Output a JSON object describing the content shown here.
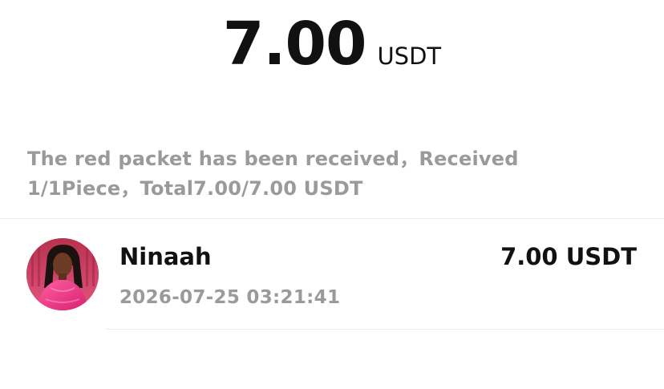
{
  "header": {
    "amount": "7.00",
    "unit": "USDT"
  },
  "summary": {
    "line1": "The red packet has been received，Received",
    "line2": "1/1Piece，Total7.00/7.00 USDT"
  },
  "records": [
    {
      "name": "Ninaah",
      "time": "2026-07-25 03:21:41",
      "amount": "7.00 USDT",
      "avatar_icon": "user-avatar-photo"
    }
  ],
  "colors": {
    "text_primary": "#111111",
    "text_secondary": "#9a9a9a",
    "divider": "#ececec",
    "avatar_accent": "#e0407a"
  }
}
